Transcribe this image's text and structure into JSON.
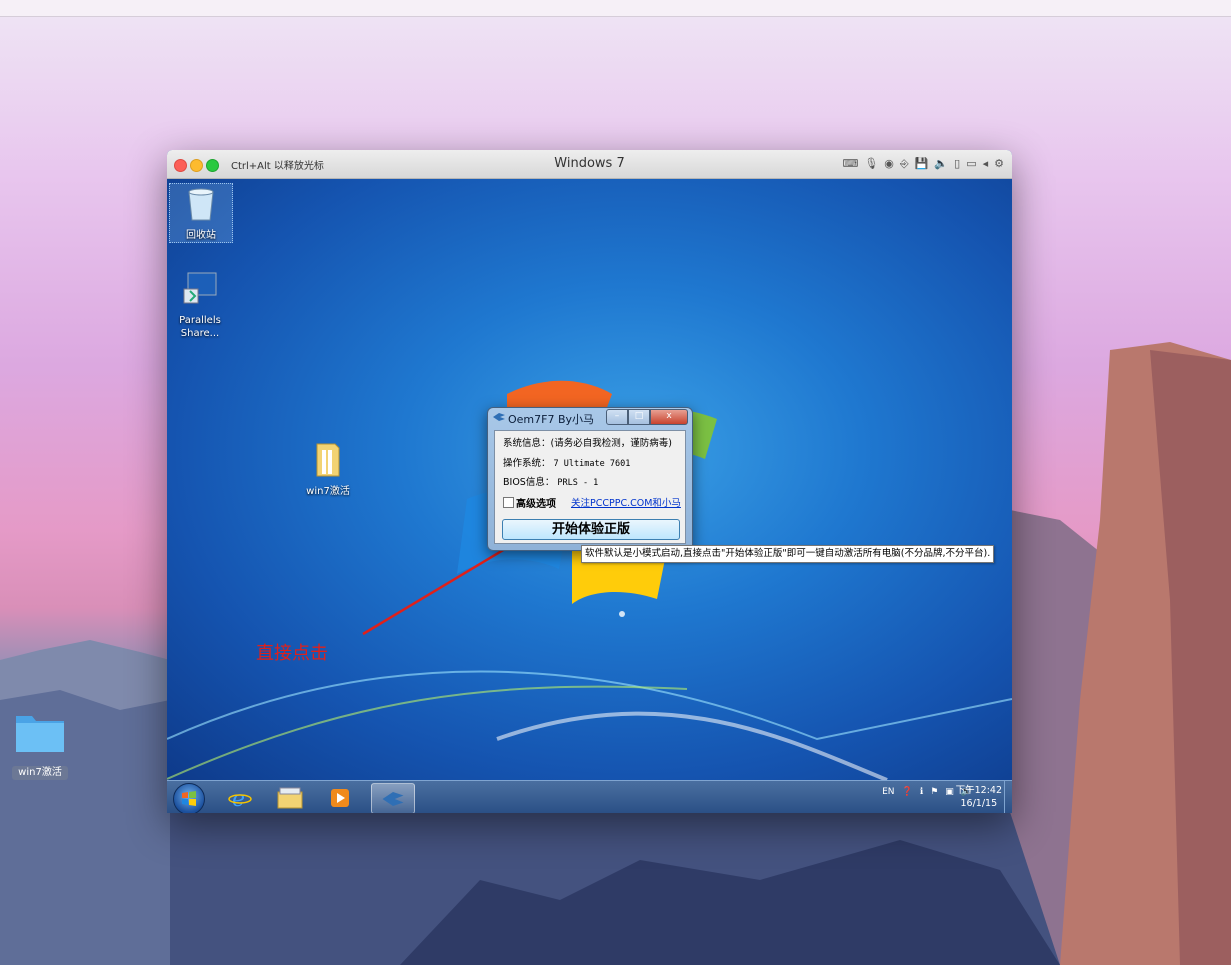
{
  "mac": {
    "desktop_folder_label": "win7激活"
  },
  "vm": {
    "hint": "Ctrl+Alt 以释放光标",
    "title": "Windows 7",
    "tools": [
      "keyboard-icon",
      "mic-icon",
      "cd-icon",
      "usb-icon",
      "floppy-icon",
      "sound-icon",
      "phone-icon",
      "folder-share-icon",
      "arrow-left-icon",
      "gear-icon"
    ]
  },
  "windows": {
    "desktop_icons": {
      "recycle_bin": "回收站",
      "parallels_line1": "Parallels",
      "parallels_line2": "Share...",
      "folder": "win7激活"
    },
    "app": {
      "title": "Oem7F7 By小马",
      "sys_info": "系统信息：(请务必自我检测，谨防病毒)",
      "os_label": "操作系统：",
      "os_value": "7 Ultimate 7601",
      "bios_label": "BIOS信息：",
      "bios_value": "PRLS  - 1",
      "advanced_label": "高级选项",
      "advanced_link": "关注PCCPPC.COM和小马",
      "start_button": "开始体验正版",
      "ctrl_close": "x"
    },
    "tooltip": "软件默认是小模式启动,直接点击\"开始体验正版\"即可一键自动激活所有电脑(不分品牌,不分平台).",
    "annotation": "直接点击",
    "taskbar": {
      "lang": "EN",
      "time": "下午12:42",
      "date": "16/1/15"
    }
  }
}
